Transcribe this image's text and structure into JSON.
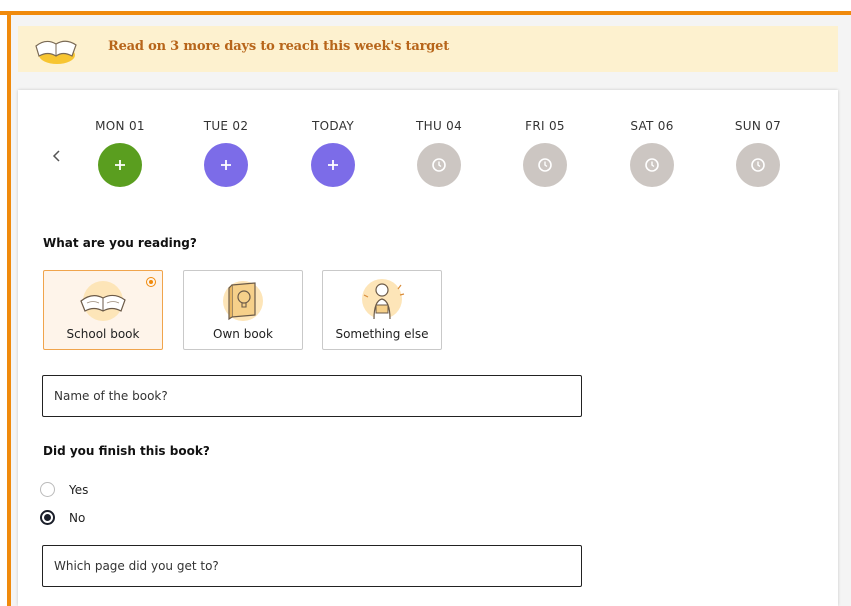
{
  "banner": {
    "text": "Read on 3 more days to reach this week's target",
    "icon": "open-book-icon"
  },
  "week": {
    "prev_icon": "chevron-left-icon",
    "days": [
      {
        "label": "MON 01",
        "state": "done",
        "icon": "plus-icon",
        "color": "#5a9e1f"
      },
      {
        "label": "TUE 02",
        "state": "add",
        "icon": "plus-icon",
        "color": "#7c6ce8"
      },
      {
        "label": "TODAY",
        "state": "add",
        "icon": "plus-icon",
        "color": "#7c6ce8"
      },
      {
        "label": "THU 04",
        "state": "future",
        "icon": "clock-icon",
        "color": "#ccc6c2"
      },
      {
        "label": "FRI 05",
        "state": "future",
        "icon": "clock-icon",
        "color": "#ccc6c2"
      },
      {
        "label": "SAT 06",
        "state": "future",
        "icon": "clock-icon",
        "color": "#ccc6c2"
      },
      {
        "label": "SUN 07",
        "state": "future",
        "icon": "clock-icon",
        "color": "#ccc6c2"
      }
    ]
  },
  "reading": {
    "title": "What are you reading?",
    "options": [
      {
        "label": "School book",
        "icon": "open-book-icon",
        "selected": true
      },
      {
        "label": "Own book",
        "icon": "closed-book-icon",
        "selected": false
      },
      {
        "label": "Something else",
        "icon": "child-reading-icon",
        "selected": false
      }
    ]
  },
  "book_name": {
    "placeholder": "Name of the book?",
    "value": ""
  },
  "finished": {
    "title": "Did you finish this book?",
    "options": [
      {
        "label": "Yes",
        "checked": false
      },
      {
        "label": "No",
        "checked": true
      }
    ]
  },
  "page_input": {
    "placeholder": "Which page did you get to?",
    "value": ""
  },
  "colors": {
    "accent": "#f08a0c",
    "banner_bg": "#fdf1cf",
    "banner_text": "#b7651a"
  }
}
